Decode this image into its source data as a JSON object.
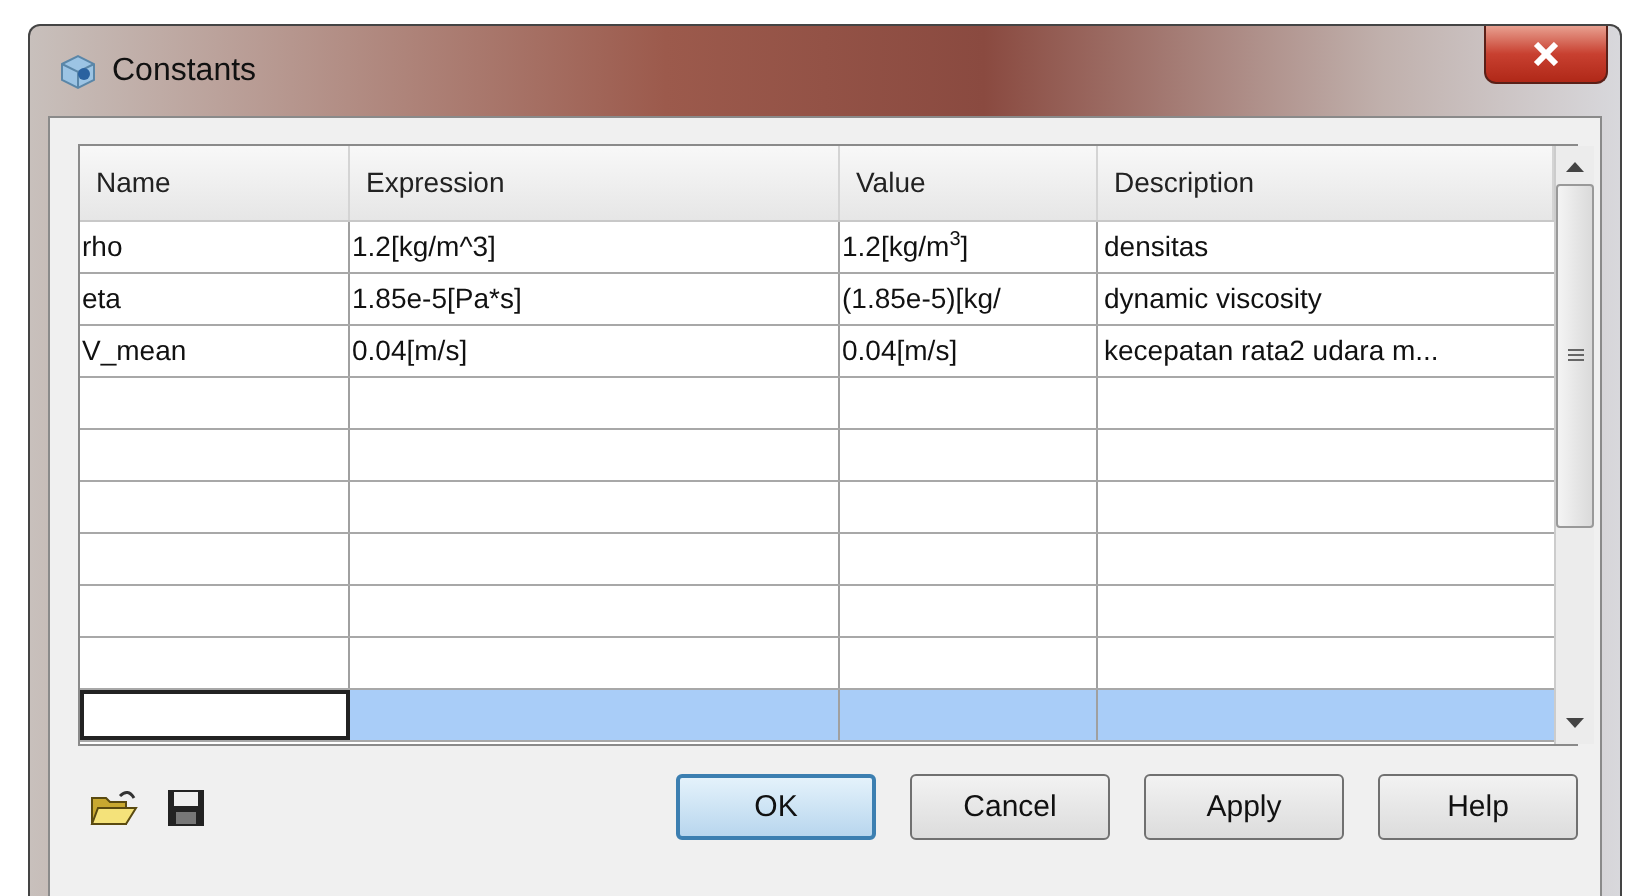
{
  "window": {
    "title": "Constants"
  },
  "table": {
    "columns": [
      "Name",
      "Expression",
      "Value",
      "Description"
    ],
    "rows": [
      {
        "name": "rho",
        "expression": "1.2[kg/m^3]",
        "value": "1.2[kg/m$^{3}$]",
        "description": "densitas",
        "selected": false
      },
      {
        "name": "eta",
        "expression": "1.85e-5[Pa*s]",
        "value": "(1.85e-5)[kg/",
        "description": "dynamic viscosity",
        "selected": false
      },
      {
        "name": "V_mean",
        "expression": "0.04[m/s]",
        "value": "0.04[m/s]",
        "description": "kecepatan rata2 udara m...",
        "selected": false
      },
      {
        "selected": false
      },
      {
        "selected": false
      },
      {
        "selected": false
      },
      {
        "selected": false
      },
      {
        "selected": false
      },
      {
        "selected": false
      },
      {
        "selected": true
      }
    ]
  },
  "buttons": [
    {
      "label": "OK",
      "default": true
    },
    {
      "label": "Cancel",
      "default": false
    },
    {
      "label": "Apply",
      "default": false
    },
    {
      "label": "Help",
      "default": false
    }
  ]
}
